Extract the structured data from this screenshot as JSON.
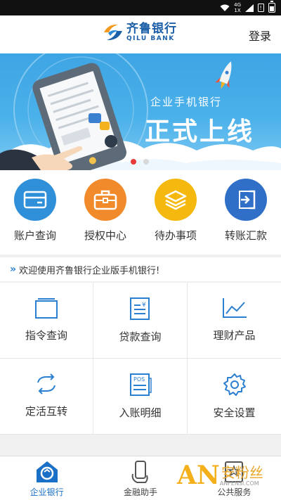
{
  "status_bar": {
    "network_top": "4G",
    "network_bottom": "1X"
  },
  "header": {
    "logo_cn": "齐鲁银行",
    "logo_en": "QILU BANK",
    "login_label": "登录"
  },
  "banner": {
    "line1": "企业手机银行",
    "line2": "正式上线",
    "slides_total": 2,
    "slide_active": 1
  },
  "quick_actions": [
    {
      "label": "账户查询",
      "icon": "card-icon",
      "color": "#2f8fd8"
    },
    {
      "label": "授权中心",
      "icon": "briefcase-icon",
      "color": "#f08a2a"
    },
    {
      "label": "待办事项",
      "icon": "layers-icon",
      "color": "#f4b80e"
    },
    {
      "label": "转账汇款",
      "icon": "transfer-icon",
      "color": "#2f6fc8"
    }
  ],
  "notice": {
    "text": "欢迎使用齐鲁银行企业版手机银行!"
  },
  "grid": [
    {
      "label": "指令查询",
      "icon": "window-icon"
    },
    {
      "label": "贷款查询",
      "icon": "loan-doc-icon"
    },
    {
      "label": "理财产品",
      "icon": "chart-icon"
    },
    {
      "label": "定活互转",
      "icon": "swap-icon"
    },
    {
      "label": "入账明细",
      "icon": "pos-icon"
    },
    {
      "label": "安全设置",
      "icon": "gear-icon"
    }
  ],
  "tabs": [
    {
      "label": "企业银行",
      "icon": "home-icon",
      "active": true
    },
    {
      "label": "金融助手",
      "icon": "phone-hand-icon",
      "active": false
    },
    {
      "label": "公共服务",
      "icon": "star-doc-icon",
      "active": false
    }
  ],
  "watermark": {
    "logo": "AN",
    "text": "安粉丝",
    "sub": "ANFENSI.COM"
  },
  "colors": {
    "accent": "#1a6fc6",
    "banner": "#3ea5e4"
  }
}
